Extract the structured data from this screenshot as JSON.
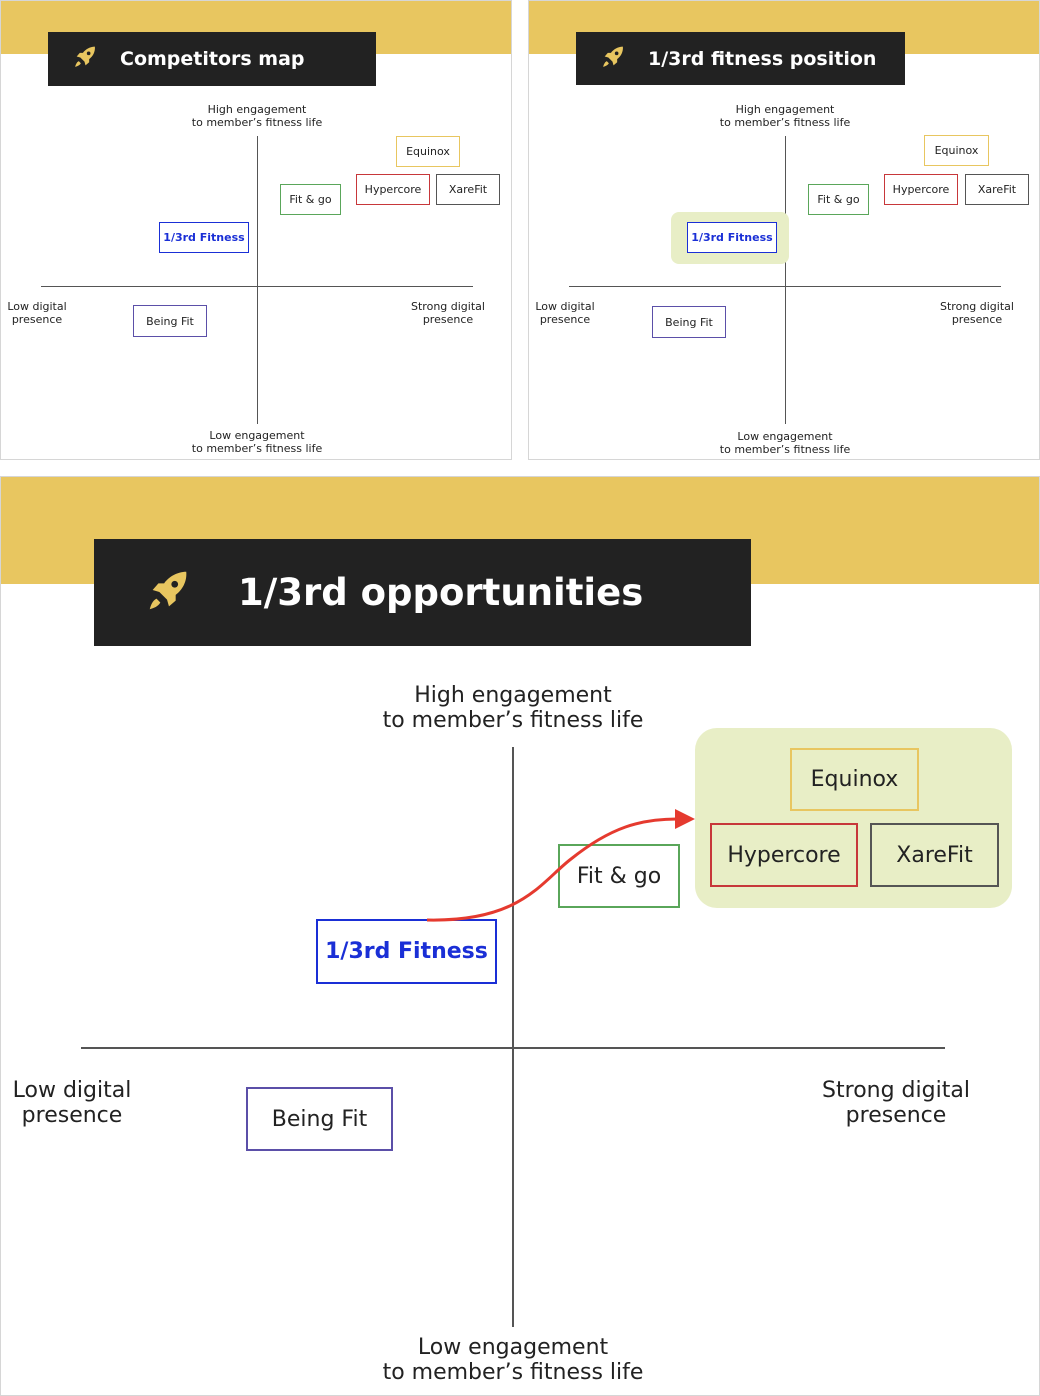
{
  "slides": {
    "competitors_map": {
      "title": "Competitors map"
    },
    "fitness_position": {
      "title": "1/3rd fitness position"
    },
    "opportunities": {
      "title": "1/3rd opportunities"
    }
  },
  "axes": {
    "top": "High engagement\nto member’s fitness life",
    "bottom": "Low engagement\nto member’s fitness life",
    "left": "Low digital\npresence",
    "right": "Strong digital\npresence"
  },
  "companies": {
    "equinox": "Equinox",
    "hypercore": "Hypercore",
    "xarefit": "XareFit",
    "fitgo": "Fit & go",
    "third": "1/3rd Fitness",
    "beingfit": "Being Fit"
  },
  "colors": {
    "accent_band": "#e8c660",
    "title_bar": "#222222",
    "rocket": "#e8c660",
    "highlight": "#e8eec6",
    "third_fitness": "#1a2fd6",
    "equinox": "#e8c660",
    "hypercore": "#c7373a",
    "xarefit": "#555555",
    "fitgo": "#5aa65a",
    "beingfit": "#5b4fa8",
    "arrow": "#e53a2f"
  }
}
